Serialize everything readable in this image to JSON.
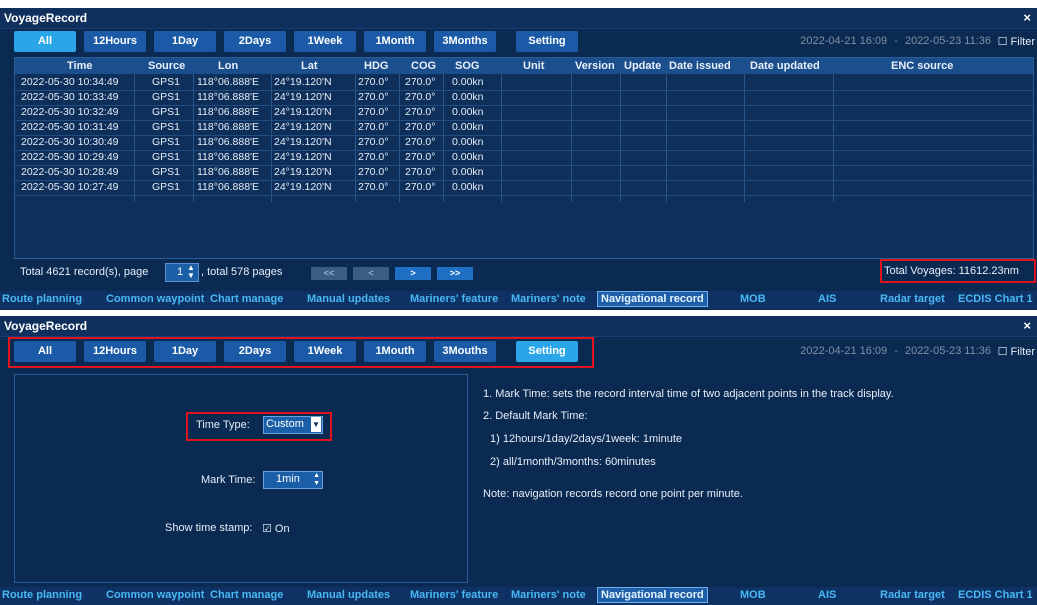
{
  "window1": {
    "title": "VoyageRecord",
    "close_label": "×",
    "tabs": [
      "All",
      "12Hours",
      "1Day",
      "2Days",
      "1Week",
      "1Month",
      "3Months",
      "Setting"
    ],
    "date_from": "2022-04-21 16:09",
    "date_sep": "-",
    "date_to": "2022-05-23 11:36",
    "filter_label": "☐ Filter",
    "columns": [
      "Time",
      "Source",
      "Lon",
      "Lat",
      "HDG",
      "COG",
      "SOG",
      "Unit",
      "Version",
      "Update",
      "Date issued",
      "Date updated",
      "ENC source"
    ],
    "rows": [
      [
        "2022-05-30 10:34:49",
        "GPS1",
        "118°06.888'E",
        "24°19.120'N",
        "270.0°",
        "270.0°",
        "0.00kn"
      ],
      [
        "2022-05-30 10:33:49",
        "GPS1",
        "118°06.888'E",
        "24°19.120'N",
        "270.0°",
        "270.0°",
        "0.00kn"
      ],
      [
        "2022-05-30 10:32:49",
        "GPS1",
        "118°06.888'E",
        "24°19.120'N",
        "270.0°",
        "270.0°",
        "0.00kn"
      ],
      [
        "2022-05-30 10:31:49",
        "GPS1",
        "118°06.888'E",
        "24°19.120'N",
        "270.0°",
        "270.0°",
        "0.00kn"
      ],
      [
        "2022-05-30 10:30:49",
        "GPS1",
        "118°06.888'E",
        "24°19.120'N",
        "270.0°",
        "270.0°",
        "0.00kn"
      ],
      [
        "2022-05-30 10:29:49",
        "GPS1",
        "118°06.888'E",
        "24°19.120'N",
        "270.0°",
        "270.0°",
        "0.00kn"
      ],
      [
        "2022-05-30 10:28:49",
        "GPS1",
        "118°06.888'E",
        "24°19.120'N",
        "270.0°",
        "270.0°",
        "0.00kn"
      ],
      [
        "2022-05-30 10:27:49",
        "GPS1",
        "118°06.888'E",
        "24°19.120'N",
        "270.0°",
        "270.0°",
        "0.00kn"
      ]
    ],
    "pager": {
      "prefix": "Total 4621 record(s), page",
      "page": "1",
      "suffix": ", total 578 pages",
      "first": "<<",
      "prev": "<",
      "next": ">",
      "last": ">>"
    },
    "total_voyages": "Total Voyages: 11612.23nm"
  },
  "bottom_nav": [
    "Route planning",
    "Common waypoint",
    "Chart manage",
    "Manual updates",
    "Mariners' feature",
    "Mariners' note",
    "Navigational record",
    "MOB",
    "AIS",
    "Radar target",
    "ECDIS Chart 1"
  ],
  "window2": {
    "title": "VoyageRecord",
    "close_label": "×",
    "tabs": [
      "All",
      "12Hours",
      "1Day",
      "2Days",
      "1Week",
      "1Mouth",
      "3Mouths",
      "Setting"
    ],
    "date_from": "2022-04-21 16:09",
    "date_sep": "-",
    "date_to": "2022-05-23 11:36",
    "filter_label": "☐ Filter",
    "time_type_label": "Time Type:",
    "time_type_value": "Custom",
    "mark_time_label": "Mark Time:",
    "mark_time_value": "1min",
    "show_stamp_label": "Show time stamp:",
    "show_stamp_value": "☑ On",
    "notes": [
      "1. Mark Time: sets the record interval time of two adjacent points in the track display.",
      "2. Default Mark Time:",
      "1) 12hours/1day/2days/1week: 1minute",
      "2) all/1month/3months: 60minutes",
      "Note: navigation records record one point per minute."
    ]
  },
  "colors": {
    "panel_bg": "#0b2a52",
    "tab_bg": "#1a5aa6",
    "tab_active": "#2aa6e8",
    "highlight": "#e0141e",
    "nav_text": "#49b8f5"
  }
}
